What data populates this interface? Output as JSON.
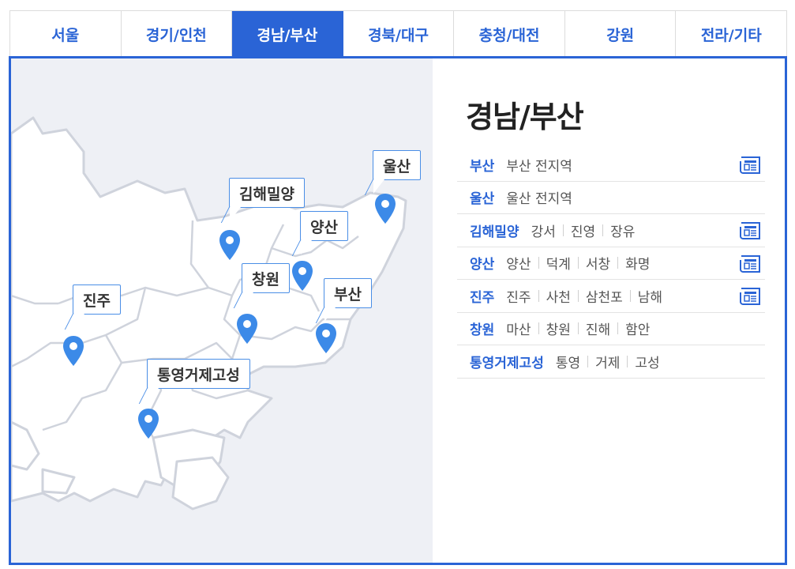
{
  "tabs": [
    {
      "label": "서울",
      "active": false
    },
    {
      "label": "경기/인천",
      "active": false
    },
    {
      "label": "경남/부산",
      "active": true
    },
    {
      "label": "경북/대구",
      "active": false
    },
    {
      "label": "충청/대전",
      "active": false
    },
    {
      "label": "강원",
      "active": false
    },
    {
      "label": "전라/기타",
      "active": false
    }
  ],
  "region_title": "경남/부산",
  "map_labels": {
    "ulsan": "울산",
    "gimhae": "김해밀양",
    "yangsan": "양산",
    "changwon": "창원",
    "busan": "부산",
    "jinju": "진주",
    "tongyeong": "통영거제고성"
  },
  "rows": [
    {
      "city": "부산",
      "subs": [
        "부산 전지역"
      ],
      "news_icon": true
    },
    {
      "city": "울산",
      "subs": [
        "울산 전지역"
      ],
      "news_icon": false
    },
    {
      "city": "김해밀양",
      "subs": [
        "강서",
        "진영",
        "장유"
      ],
      "news_icon": true
    },
    {
      "city": "양산",
      "subs": [
        "양산",
        "덕계",
        "서창",
        "화명"
      ],
      "news_icon": true
    },
    {
      "city": "진주",
      "subs": [
        "진주",
        "사천",
        "삼천포",
        "남해"
      ],
      "news_icon": true
    },
    {
      "city": "창원",
      "subs": [
        "마산",
        "창원",
        "진해",
        "함안"
      ],
      "news_icon": false
    },
    {
      "city": "통영거제고성",
      "subs": [
        "통영",
        "거제",
        "고성"
      ],
      "news_icon": false
    }
  ],
  "colors": {
    "accent": "#2a64d6",
    "pin": "#3c8ae8",
    "map_bg": "#eef0f5",
    "land": "#ffffff",
    "border": "#cfd3dc"
  },
  "icons": {
    "pin": "map-pin-icon",
    "news": "newspaper-icon"
  }
}
